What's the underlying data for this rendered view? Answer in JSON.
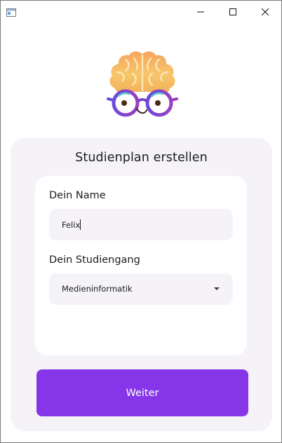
{
  "window": {
    "controls": [
      "minimize",
      "maximize",
      "close"
    ]
  },
  "logo": {
    "icon": "brain-with-glasses-logo"
  },
  "form": {
    "title": "Studienplan erstellen",
    "name_label": "Dein Name",
    "name_value": "Felix",
    "course_label": "Dein Studiengang",
    "course_value": "Medieninformatik",
    "submit_label": "Weiter"
  },
  "colors": {
    "accent": "#8636E8",
    "card_bg": "#F5F3F8",
    "field_bg": "#F5F3F8",
    "text": "#1D1D1F"
  }
}
